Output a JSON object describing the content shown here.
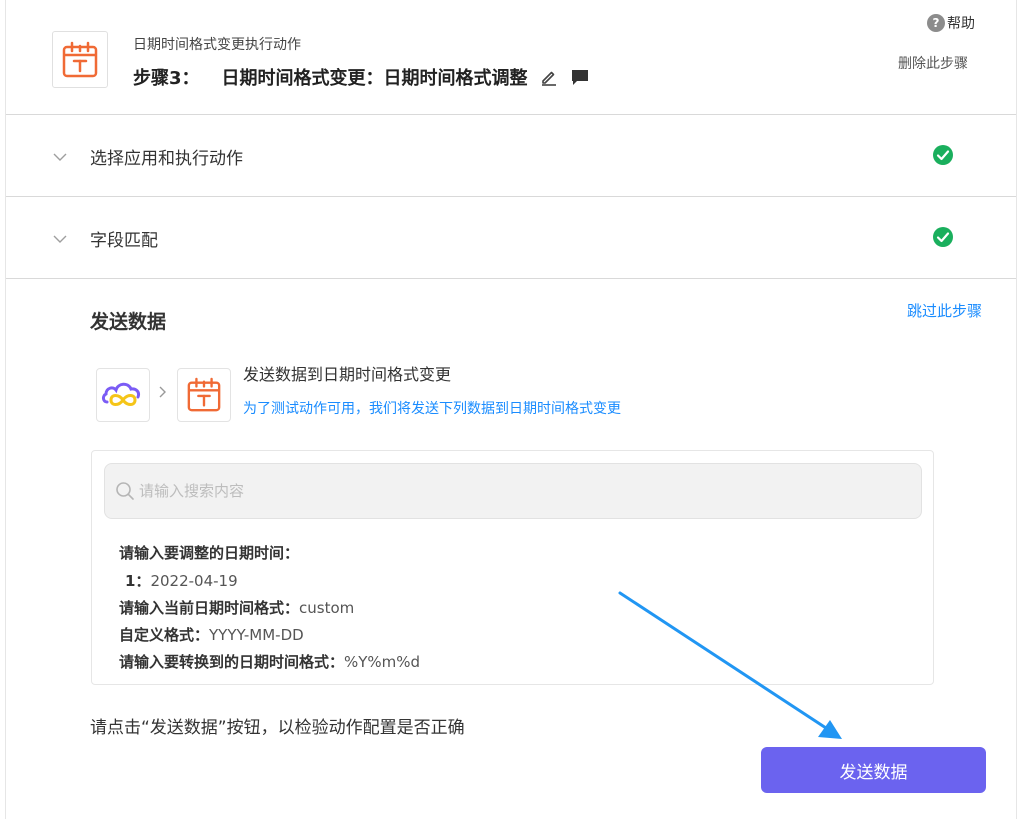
{
  "header": {
    "subtitle": "日期时间格式变更执行动作",
    "step_label": "步骤3：",
    "step_name": "日期时间格式变更：日期时间格式调整",
    "help_label": "帮助",
    "delete_label": "删除此步骤"
  },
  "sections": [
    {
      "label": "选择应用和执行动作",
      "status": "complete"
    },
    {
      "label": "字段匹配",
      "status": "complete"
    }
  ],
  "send_data": {
    "title": "发送数据",
    "skip_label": "跳过此步骤",
    "flow_title": "发送数据到日期时间格式变更",
    "flow_desc": "为了测试动作可用，我们将发送下列数据到日期时间格式变更",
    "search_placeholder": "请输入搜索内容",
    "fields": [
      {
        "key": "请输入要调整的日期时间：",
        "value": ""
      },
      {
        "key": "1：",
        "value": "2022-04-19"
      },
      {
        "key": "请输入当前日期时间格式：",
        "value": "custom"
      },
      {
        "key": "自定义格式：",
        "value": "YYYY-MM-DD"
      },
      {
        "key": "请输入要转换到的日期时间格式：",
        "value": "%Y%m%d"
      }
    ],
    "hint": "请点击“发送数据”按钮，以检验动作配置是否正确",
    "button_label": "发送数据"
  },
  "colors": {
    "accent": "#6b63ef",
    "link": "#1a8cff",
    "success": "#1aaf5d",
    "app_orange": "#f06a35",
    "annotation_arrow": "#2196f3"
  },
  "icons": {
    "app": "calendar-t-icon",
    "source_app": "cloud-infinity-logo",
    "edit": "pencil-icon",
    "comment": "comment-icon",
    "help": "question-circle-icon",
    "check": "check-circle-icon",
    "chevron": "chevron-down-icon",
    "search": "search-icon"
  }
}
